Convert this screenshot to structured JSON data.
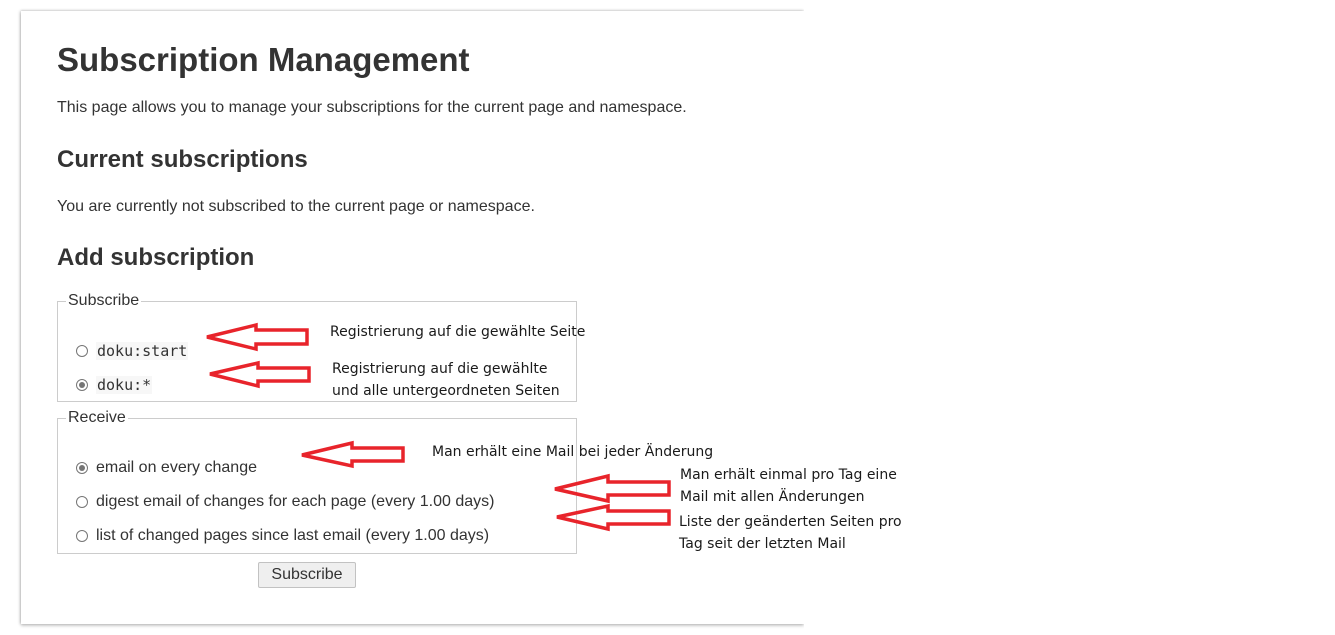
{
  "page": {
    "title": "Subscription Management",
    "intro": "This page allows you to manage your subscriptions for the current page and namespace.",
    "current_heading": "Current subscriptions",
    "current_text": "You are currently not subscribed to the current page or namespace.",
    "add_heading": "Add subscription"
  },
  "subscribe": {
    "legend": "Subscribe",
    "options": [
      {
        "label": "doku:start",
        "checked": false
      },
      {
        "label": "doku:*",
        "checked": true
      }
    ]
  },
  "receive": {
    "legend": "Receive",
    "options": [
      {
        "label": "email on every change",
        "checked": true
      },
      {
        "label": "digest email of changes for each page (every 1.00 days)",
        "checked": false
      },
      {
        "label": "list of changed pages since last email (every 1.00 days)",
        "checked": false
      }
    ]
  },
  "submit_label": "Subscribe",
  "annotations": {
    "arrow_color": "#e8242b",
    "notes": [
      {
        "lines": [
          "Registrierung auf die gewählte Seite"
        ]
      },
      {
        "lines": [
          "Registrierung auf die gewählte",
          "und alle untergeordneten Seiten"
        ]
      },
      {
        "lines": [
          "Man erhält eine Mail bei jeder Änderung"
        ]
      },
      {
        "lines": [
          "Man erhält einmal pro Tag eine",
          "Mail mit allen Änderungen"
        ]
      },
      {
        "lines": [
          "Liste der geänderten Seiten pro",
          "Tag seit der letzten Mail"
        ]
      }
    ]
  }
}
